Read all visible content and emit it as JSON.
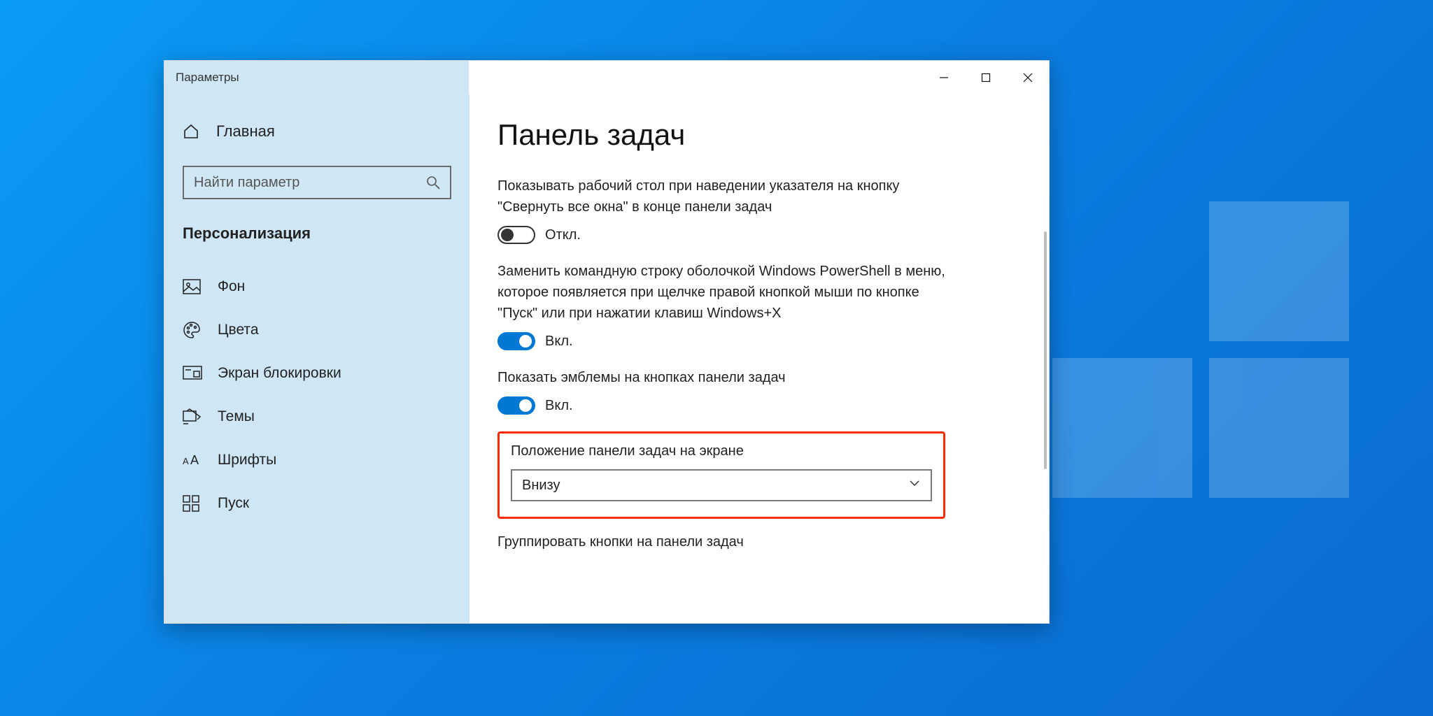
{
  "window": {
    "title": "Параметры"
  },
  "sidebar": {
    "home": "Главная",
    "search_placeholder": "Найти параметр",
    "category": "Персонализация",
    "items": [
      {
        "label": "Фон"
      },
      {
        "label": "Цвета"
      },
      {
        "label": "Экран блокировки"
      },
      {
        "label": "Темы"
      },
      {
        "label": "Шрифты"
      },
      {
        "label": "Пуск"
      }
    ]
  },
  "content": {
    "heading": "Панель задач",
    "settings": [
      {
        "text": "Показывать рабочий стол при наведении указателя на кнопку \"Свернуть все окна\" в конце панели задач",
        "on": false,
        "state_label": "Откл."
      },
      {
        "text": "Заменить командную строку оболочкой Windows PowerShell в меню, которое появляется при щелчке правой кнопкой мыши по кнопке \"Пуск\" или при нажатии клавиш Windows+X",
        "on": true,
        "state_label": "Вкл."
      },
      {
        "text": "Показать эмблемы на кнопках панели задач",
        "on": true,
        "state_label": "Вкл."
      }
    ],
    "position": {
      "label": "Положение панели задач на экране",
      "value": "Внизу"
    },
    "group_label": "Группировать кнопки на панели задач"
  }
}
